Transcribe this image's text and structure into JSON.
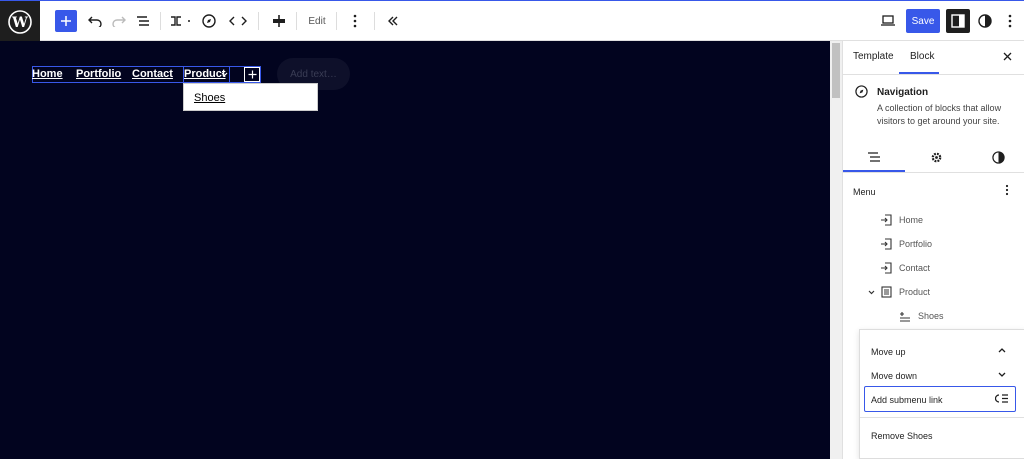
{
  "toolbar": {
    "edit_label": "Edit",
    "save_label": "Save"
  },
  "canvas": {
    "nav_links": [
      "Home",
      "Portfolio",
      "Contact",
      "Product"
    ],
    "add_text_placeholder": "Add text…",
    "submenu_item": "Shoes"
  },
  "sidebar": {
    "tabs": [
      "Template",
      "Block"
    ],
    "active_tab": "Block",
    "block_name": "Navigation",
    "block_description": "A collection of blocks that allow visitors to get around your site.",
    "menu_heading": "Menu",
    "menu_items": [
      {
        "label": "Home",
        "level": 0,
        "icon": "link-icon"
      },
      {
        "label": "Portfolio",
        "level": 0,
        "icon": "link-icon"
      },
      {
        "label": "Contact",
        "level": 0,
        "icon": "link-icon"
      },
      {
        "label": "Product",
        "level": 0,
        "icon": "page-icon",
        "expanded": true
      },
      {
        "label": "Shoes",
        "level": 1,
        "icon": "submenu-link-icon"
      }
    ]
  },
  "popover": {
    "move_up": "Move up",
    "move_down": "Move down",
    "add_submenu": "Add submenu link",
    "remove": "Remove Shoes"
  },
  "colors": {
    "accent": "#3858e9",
    "canvas_bg": "#02041f"
  }
}
